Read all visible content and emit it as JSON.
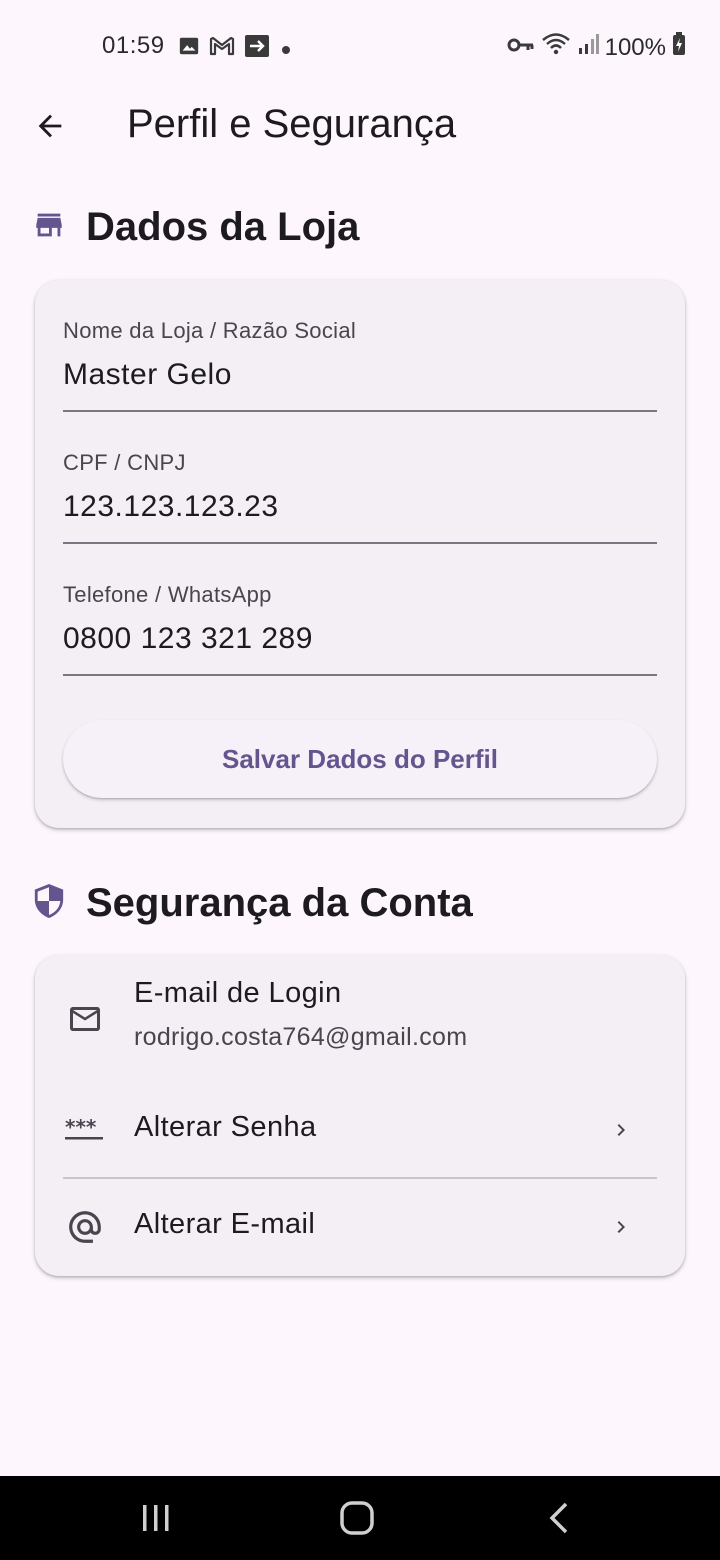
{
  "status_bar": {
    "time": "01:59",
    "battery": "100%",
    "icons_left": [
      "image-icon",
      "gmail-icon",
      "arrow-box-icon",
      "dot-icon"
    ],
    "icons_right": [
      "vpn-key-icon",
      "wifi-icon",
      "signal-icon",
      "battery-charging-icon"
    ]
  },
  "top_bar": {
    "back_icon": "arrow-back-icon",
    "title": "Perfil e Segurança"
  },
  "store_section": {
    "icon": "store-icon",
    "title": "Dados da Loja",
    "fields": [
      {
        "label": "Nome da Loja / Razão Social",
        "value": "Master Gelo"
      },
      {
        "label": "CPF / CNPJ",
        "value": "123.123.123.23"
      },
      {
        "label": "Telefone / WhatsApp",
        "value": "0800 123 321 289"
      }
    ],
    "save_button": "Salvar Dados do Perfil"
  },
  "security_section": {
    "icon": "shield-icon",
    "title": "Segurança da Conta",
    "email_row": {
      "icon": "mail-icon",
      "title": "E-mail de Login",
      "subtitle": "rodrigo.costa764@gmail.com"
    },
    "password_row": {
      "icon": "password-icon",
      "title": "Alterar Senha"
    },
    "email_change_row": {
      "icon": "at-icon",
      "title": "Alterar E-mail"
    }
  },
  "colors": {
    "background": "#fdf7fd",
    "card": "#f4eff5",
    "accent": "#65558f",
    "text": "#1d1b20"
  }
}
